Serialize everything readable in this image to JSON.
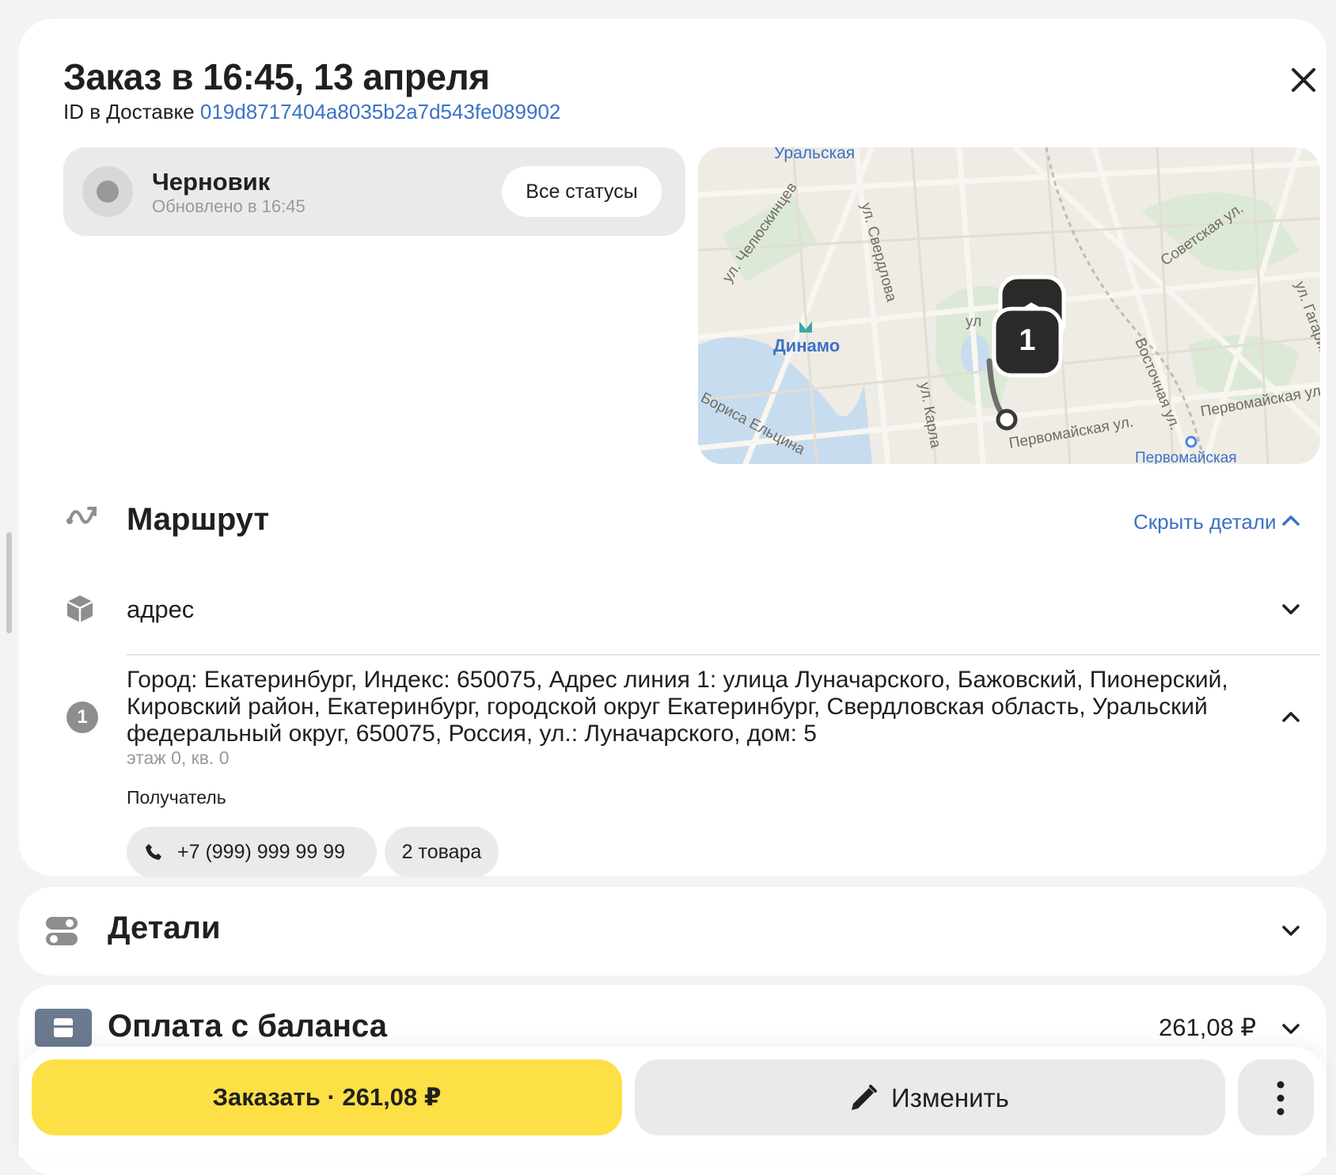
{
  "header": {
    "title": "Заказ в 16:45, 13 апреля",
    "id_prefix": "ID в Доставке",
    "id_value": "019d8717404a8035b2a7d543fe089902"
  },
  "status": {
    "title": "Черновик",
    "updated": "Обновлено в 16:45",
    "all_statuses_label": "Все статусы"
  },
  "map": {
    "labels": {
      "uralskaya": "Уральская",
      "chelyuskintsev": "ул. Челюскинцев",
      "sverdlova": "ул. Свердлова",
      "dinamo": "Динамо",
      "karla": "ул. Карла",
      "eltsina": "Бориса Ельцина",
      "ul_short": "ул",
      "sovetskaya": "Советская ул.",
      "gagarina": "ул. Гагарина",
      "vostochnaya": "Восточная ул.",
      "pervomayskaya_1": "Первомайская ул.",
      "pervomayskaya_2": "Первомайская ул.",
      "pervomayskaya_metro": "Первомайская"
    },
    "pin_number": "1"
  },
  "route": {
    "title": "Маршрут",
    "toggle_label": "Скрыть детали",
    "pickup_label": "адрес",
    "point_number": "1",
    "address": "Город: Екатеринбург, Индекс: 650075, Адрес линия 1: улица Луначарского, Бажовский, Пионерский, Кировский район, Екатеринбург, городской округ Екатеринбург, Свердловская область, Уральский федеральный округ, 650075, Россия, ул.: Луначарского, дом: 5",
    "floor": "этаж 0, кв. 0",
    "recipient_label": "Получатель",
    "phone": "+7 (999) 999 99 99",
    "items": "2 товара"
  },
  "details": {
    "title": "Детали"
  },
  "payment": {
    "title": "Оплата с баланса",
    "amount": "261,08 ₽"
  },
  "actions": {
    "order_label": "Заказать ·  261,08 ₽",
    "edit_label": "Изменить"
  }
}
